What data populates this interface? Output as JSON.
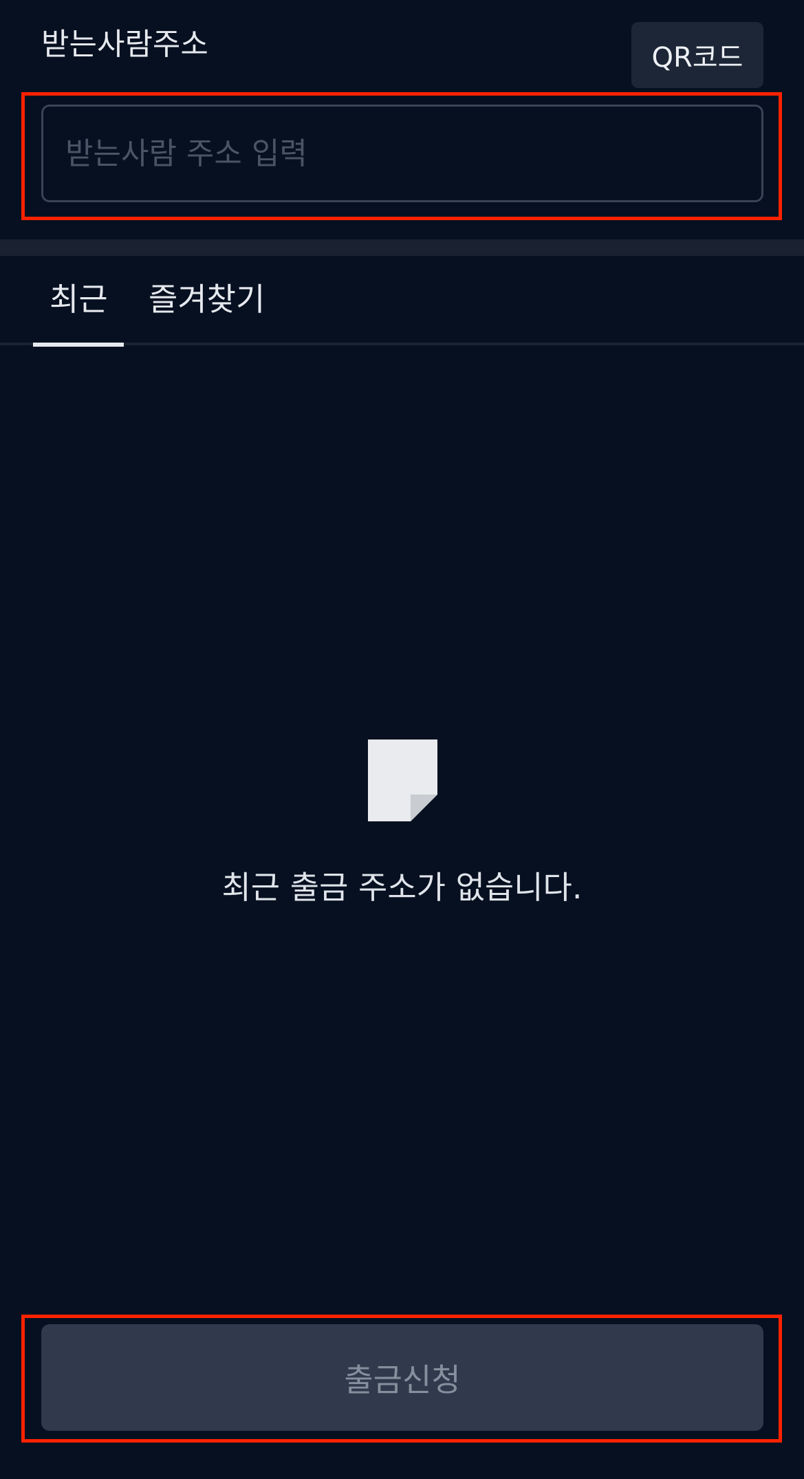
{
  "header": {
    "label": "받는사람주소",
    "qr_button_label": "QR코드"
  },
  "address_input": {
    "placeholder": "받는사람 주소 입력",
    "value": ""
  },
  "tabs": [
    {
      "label": "최근",
      "active": true
    },
    {
      "label": "즐겨찾기",
      "active": false
    }
  ],
  "empty_state": {
    "icon": "document-icon",
    "message": "최근 출금 주소가 없습니다."
  },
  "submit_button": {
    "label": "출금신청",
    "enabled": false
  },
  "colors": {
    "background": "#061020",
    "highlight": "#ff2200",
    "button_bg": "#303a4c",
    "qr_button_bg": "#1c2636"
  }
}
